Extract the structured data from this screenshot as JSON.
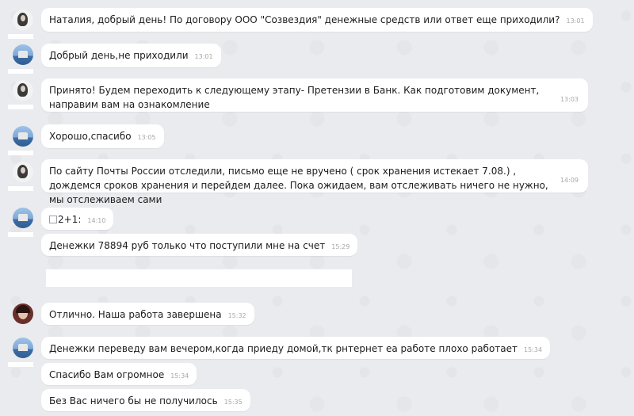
{
  "messages": [
    {
      "text": "Наталия, добрый день! По договору ООО \"Созвездия\" денежные средств или ответ еще приходили?",
      "time": "13:01"
    },
    {
      "text": "Добрый день,не приходили",
      "time": "13:01"
    },
    {
      "text": "Принято! Будем переходить к следующему этапу- Претензии в Банк. Как подготовим документ, направим вам на ознакомление",
      "time": "13:03"
    },
    {
      "text": "Хорошо,спасибо",
      "time": "13:05"
    },
    {
      "text": "По сайту Почты России отследили, письмо еще не вручено ( срок хранения истекает 7.08.) , дождемся сроков хранения и перейдем далее. Пока ожидаем, вам отслеживать ничего не нужно, мы отслеживаем сами",
      "time": "14:09"
    },
    {
      "text": "2+1:",
      "time": "14:10"
    },
    {
      "text": "Денежки 78894 руб только что поступили мне на счет",
      "time": "15:29"
    },
    {
      "text": "Отлично. Наша работа завершена",
      "time": "15:32"
    },
    {
      "text": "Денежки переведу вам вечером,когда приеду домой,тк рнтернет еа работе плохо работает",
      "time": "15:34"
    },
    {
      "text": "Спасибо Вам огромное",
      "time": "15:34"
    },
    {
      "text": "Без Вас ничего бы не получилось",
      "time": "15:35"
    }
  ],
  "icons": {
    "broken_image": "broken-image-icon"
  }
}
